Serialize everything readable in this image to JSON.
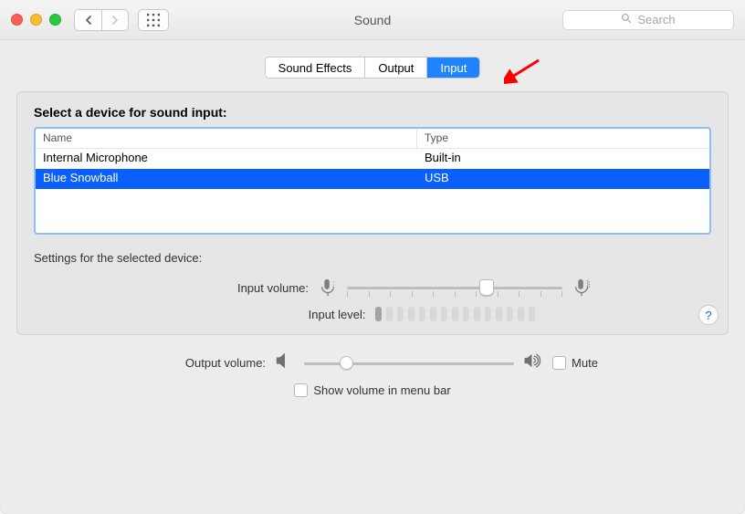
{
  "window": {
    "title": "Sound"
  },
  "search": {
    "placeholder": "Search"
  },
  "tabs": [
    {
      "label": "Sound Effects",
      "active": false
    },
    {
      "label": "Output",
      "active": false
    },
    {
      "label": "Input",
      "active": true
    }
  ],
  "heading": "Select a device for sound input:",
  "table": {
    "columns": {
      "name": "Name",
      "type": "Type"
    },
    "rows": [
      {
        "name": "Internal Microphone",
        "type": "Built-in",
        "selected": false
      },
      {
        "name": "Blue Snowball",
        "type": "USB",
        "selected": true
      }
    ]
  },
  "settings": {
    "title": "Settings for the selected device:",
    "input_volume_label": "Input volume:",
    "input_volume_percent": 66,
    "input_level_label": "Input level:",
    "input_level_bars_total": 15,
    "input_level_bars_active": 1
  },
  "footer": {
    "output_volume_label": "Output volume:",
    "output_volume_percent": 18,
    "mute_label": "Mute",
    "mute_checked": false,
    "menubar_label": "Show volume in menu bar",
    "menubar_checked": false
  },
  "colors": {
    "accent": "#1f83ff",
    "selection": "#0a5fff",
    "annotation_arrow": "#ff0000"
  }
}
